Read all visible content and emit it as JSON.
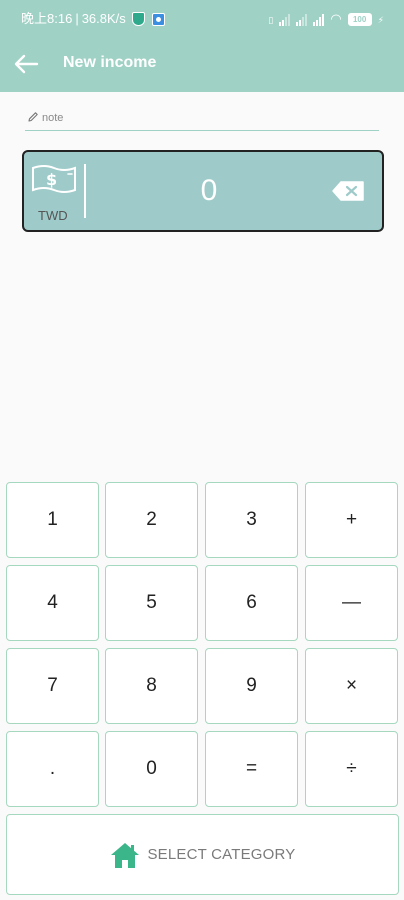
{
  "status_bar": {
    "time": "晚上8:16",
    "separator": "|",
    "speed": "36.8K/s",
    "battery": "100"
  },
  "app_bar": {
    "title": "New income"
  },
  "note": {
    "placeholder": "note",
    "value": ""
  },
  "amount": {
    "currency": "TWD",
    "value": "0"
  },
  "keypad": {
    "keys": [
      "1",
      "2",
      "3",
      "+",
      "4",
      "5",
      "6",
      "—",
      "7",
      "8",
      "9",
      "×",
      ".",
      "0",
      "=",
      "÷"
    ]
  },
  "select_category": {
    "label": "SELECT CATEGORY"
  },
  "colors": {
    "accent": "#9fd1c5",
    "card": "#9ecbc9",
    "key_border": "#a6d8bf",
    "home_icon": "#3bb58a"
  }
}
